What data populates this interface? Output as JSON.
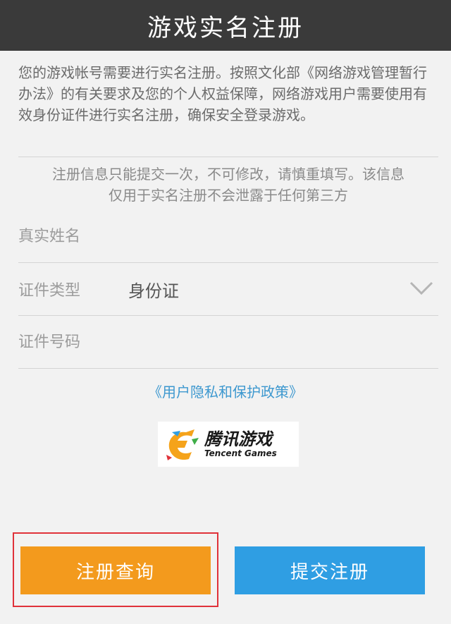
{
  "header": {
    "title": "游戏实名注册"
  },
  "intro": {
    "text": "您的游戏帐号需要进行实名注册。按照文化部《网络游戏管理暂行办法》的有关要求及您的个人权益保障，网络游戏用户需要使用有效身份证件进行实名注册，确保安全登录游戏。"
  },
  "notice": {
    "line1": "注册信息只能提交一次，不可修改，请慎重填写。该信息",
    "line2": "仅用于实名注册不会泄露于任何第三方"
  },
  "form": {
    "name_placeholder": "真实姓名",
    "id_type_label": "证件类型",
    "id_type_value": "身份证",
    "id_number_placeholder": "证件号码"
  },
  "privacy_link": "《用户隐私和保护政策》",
  "logo": {
    "cn": "腾讯游戏",
    "en": "Tencent Games"
  },
  "buttons": {
    "query_label": "注册查询",
    "submit_label": "提交注册"
  },
  "colors": {
    "header_bg": "#3a3a3a",
    "link": "#3d98cf",
    "query_button": "#f39a1d",
    "submit_button": "#2f9ee3",
    "highlight": "#e0323a"
  },
  "icons": {
    "dropdown": "chevron-down-icon",
    "logo": "tencent-games-logo-icon"
  }
}
